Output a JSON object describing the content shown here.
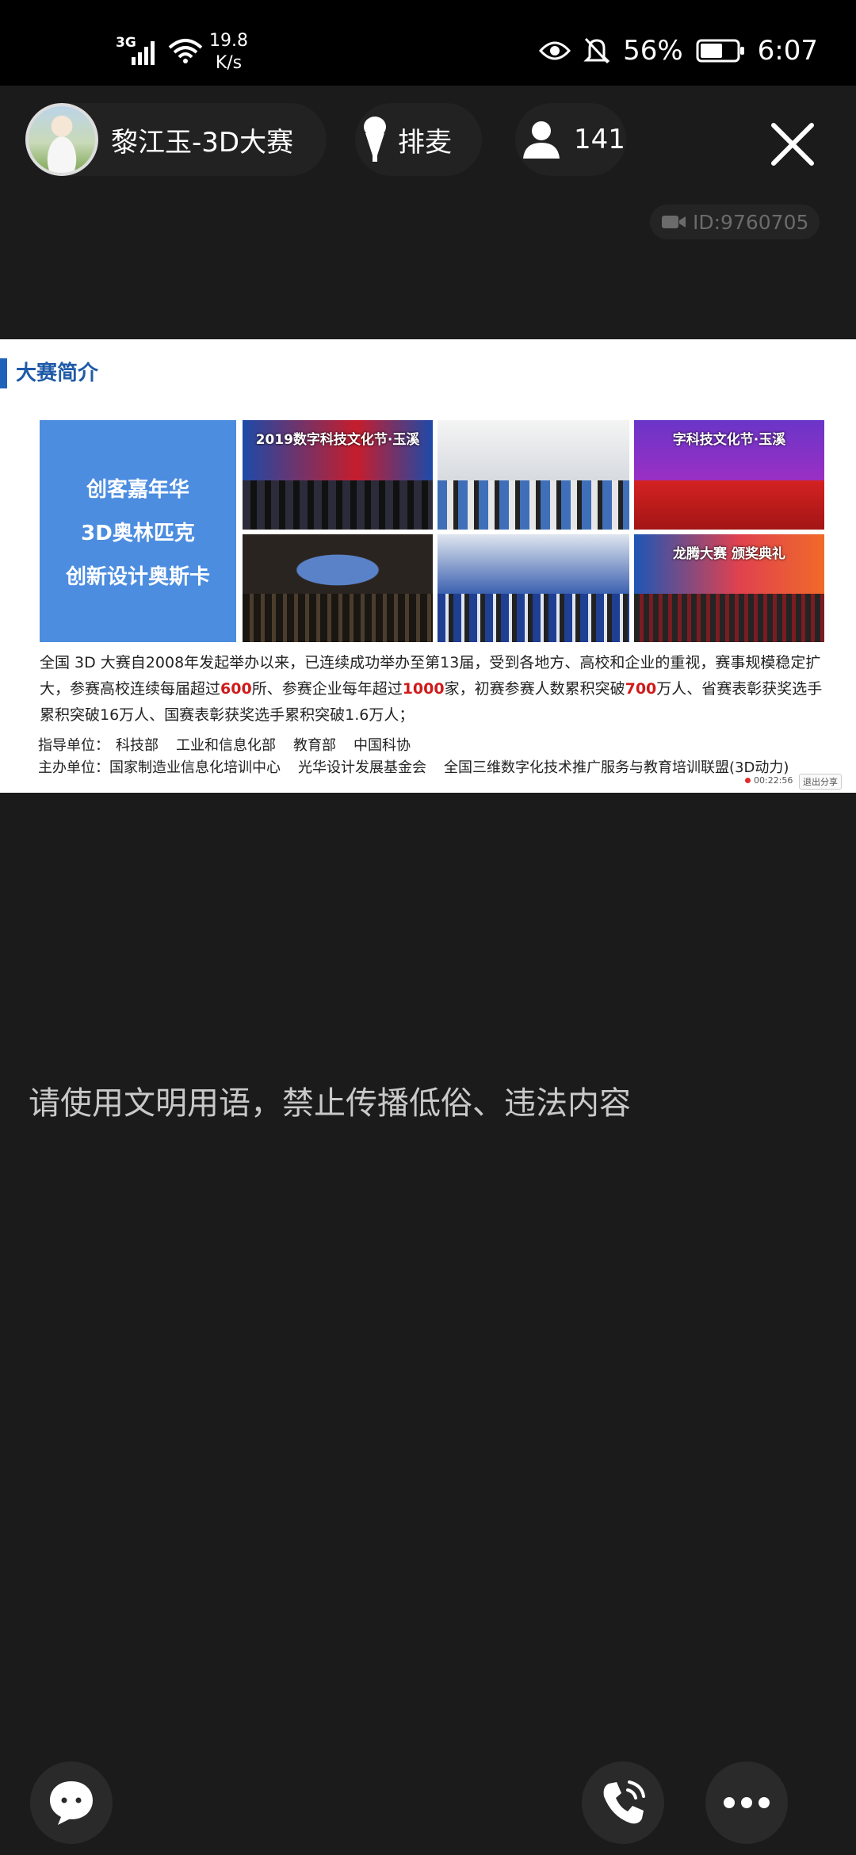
{
  "status_bar": {
    "network": "3G",
    "speed": "19.8\nK/s",
    "speed_value": "19.8",
    "speed_unit": "K/s",
    "battery": "56%",
    "time": "6:07"
  },
  "header": {
    "host_name": "黎江玉-3D大赛",
    "queue_label": "排麦",
    "viewer_count": "141",
    "room_id": "ID:9760705"
  },
  "slide": {
    "title": "大赛简介",
    "tile_lines": [
      "创客嘉年华",
      "3D奥林匹克",
      "创新设计奥斯卡"
    ],
    "photo_labels": [
      "2019数字科技文化节·玉溪",
      "",
      "字科技文化节·玉溪",
      "",
      "",
      "龙腾大赛 颁奖典礼"
    ],
    "desc_1": "全国 3D 大赛自2008年发起举办以来，已连续成功举办至第13届，受到各地方、高校和企业的重视，赛事规模稳定扩大，参赛高校连续每届超过",
    "desc_n1": "600",
    "desc_2": "所、参赛企业每年超过",
    "desc_n2": "1000",
    "desc_3": "家，初赛参赛人数累积突破",
    "desc_n3": "700",
    "desc_4": "万人、省赛表彰获奖选手累积突破16万人、国赛表彰获奖选手累积突破1.6万人；",
    "guide_label": "指导单位：",
    "guide_units": [
      "科技部",
      "工业和信息化部",
      "教育部",
      "中国科协"
    ],
    "host_label": "主办单位：",
    "host_units": [
      "国家制造业信息化培训中心",
      "光华设计发展基金会",
      "全国三维数字化技术推广服务与教育培训联盟(3D动力)"
    ],
    "rec_time": "00:22:56",
    "exit_share": "退出分享"
  },
  "notice": "请使用文明用语，禁止传播低俗、违法内容",
  "icons": {
    "chat": "chat-bubble-icon",
    "call": "phone-icon",
    "more": "more-dots-icon"
  }
}
